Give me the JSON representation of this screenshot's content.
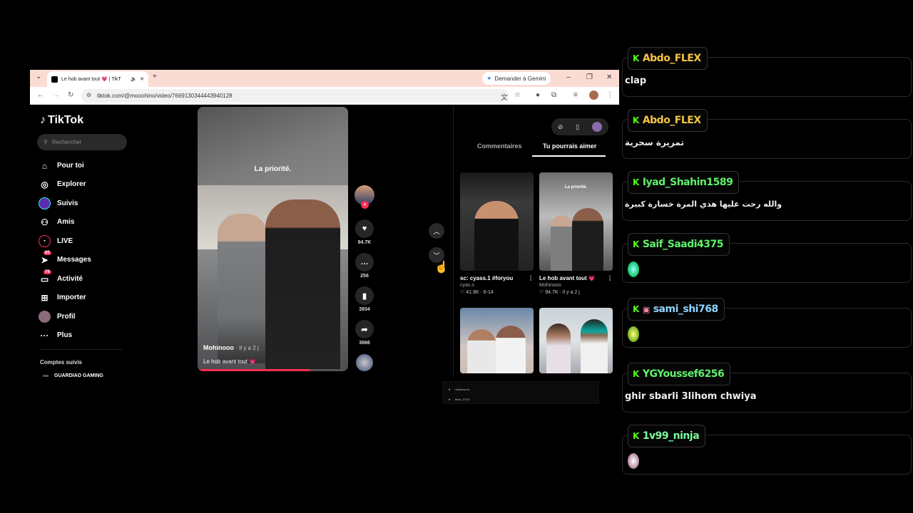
{
  "browser": {
    "tab_title": "Le hob avant tout 💗 | TikT",
    "gemini_label": "Demander à Gemini",
    "url": "tiktok.com/@mooohino/video/7669130344443940128"
  },
  "tiktok": {
    "logo_text": "TikTok",
    "search_placeholder": "Rechercher",
    "nav": [
      {
        "label": "Pour toi",
        "icon": "home-icon"
      },
      {
        "label": "Explorer",
        "icon": "compass-icon"
      },
      {
        "label": "Suivis",
        "icon": "following-icon"
      },
      {
        "label": "Amis",
        "icon": "friends-icon"
      },
      {
        "label": "LIVE",
        "icon": "live-icon"
      },
      {
        "label": "Messages",
        "icon": "messages-icon",
        "badge": "65"
      },
      {
        "label": "Activité",
        "icon": "activity-icon",
        "badge": "79"
      },
      {
        "label": "Importer",
        "icon": "upload-icon"
      },
      {
        "label": "Profil",
        "icon": "profile-icon"
      },
      {
        "label": "Plus",
        "icon": "more-icon"
      }
    ],
    "followed_title": "Comptes suivis",
    "followed_account": "GUARDIAO GAMING",
    "video": {
      "caption": "La priorité.",
      "author": "Mohinooo",
      "time": " · Il y a 2 j",
      "description": "Le hob avant tout 💗",
      "progress": 0.75
    },
    "actions": {
      "likes": "94.7K",
      "comments": "256",
      "saves": "3934",
      "shares": "3666"
    },
    "tabs": {
      "comments": "Commentaires",
      "recommend": "Tu pourrais aimer"
    },
    "cards": [
      {
        "title": "sc: cyass.1 #foryou",
        "user": "cyas.s",
        "stats": "♡ 41.9K · 6-14"
      },
      {
        "title": "Le hob avant tout 💗",
        "user": "Mohinooo",
        "stats": "♡ 94.7K · Il y a 2 j",
        "thumb_caption": "La priorité."
      }
    ]
  },
  "overlay": {
    "line1": "ruldeloscurt",
    "line2": "Abdo_FLEX"
  },
  "chat": [
    {
      "user": "Abdo_FLEX",
      "text": "clap",
      "color": "#f5c542"
    },
    {
      "user": "Abdo_FLEX",
      "text": "تمريرة سحرية",
      "color": "#f5c542"
    },
    {
      "user": "Iyad_Shahin1589",
      "text": "والله رحت عليها هذي المرة خسارة كبيرة",
      "color": "#5ef26b"
    },
    {
      "user": "Saif_Saadi4375",
      "text": "",
      "color": "#5ef26b"
    },
    {
      "user": "sami_shi768",
      "text": "",
      "color": "#8fd3ff"
    },
    {
      "user": "YGYoussef6256",
      "text": "ghir sbarli 3lihom chwiya",
      "color": "#5ef26b"
    },
    {
      "user": "1v99_ninja",
      "text": "",
      "color": "#7cfc9c"
    }
  ]
}
